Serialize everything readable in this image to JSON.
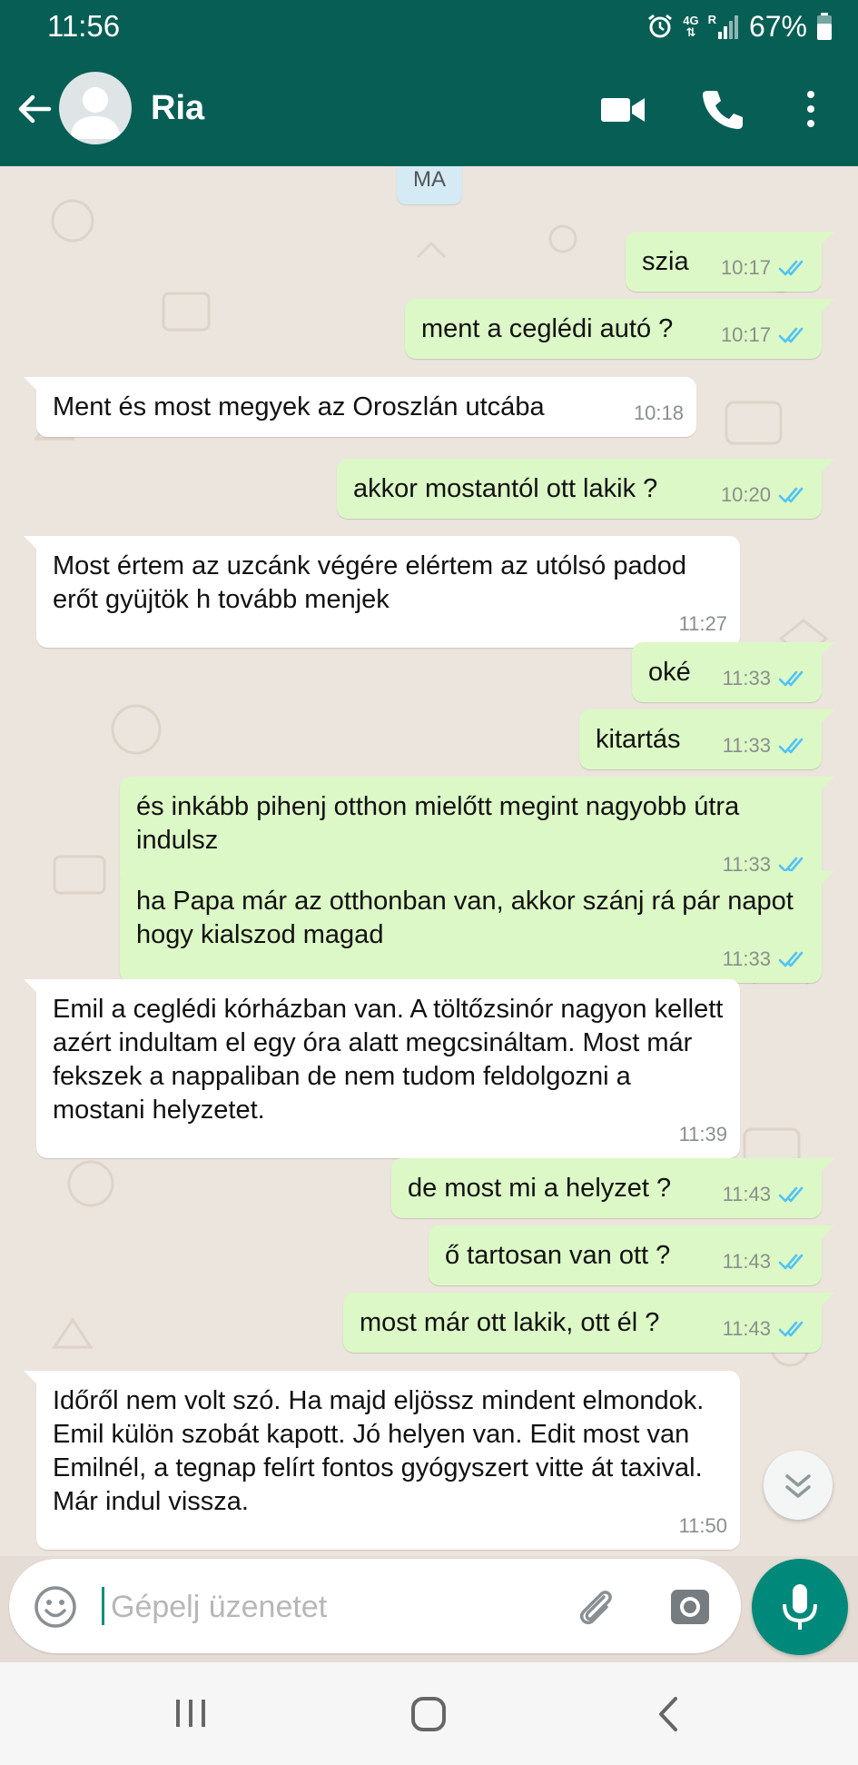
{
  "status_bar": {
    "time": "11:56",
    "network": "4G",
    "roaming": "R",
    "battery": "67%"
  },
  "header": {
    "contact_name": "Ria",
    "icons": [
      "back-arrow-icon",
      "avatar",
      "video-call-icon",
      "voice-call-icon",
      "more-options-icon"
    ]
  },
  "chat": {
    "date_label": "MA",
    "messages": [
      {
        "dir": "out",
        "text": "szia",
        "time": "10:17",
        "read": true
      },
      {
        "dir": "out",
        "text": "ment a ceglédi autó ?",
        "time": "10:17",
        "read": true
      },
      {
        "dir": "in",
        "text": "Ment és most megyek az Oroszlán utcába",
        "time": "10:18"
      },
      {
        "dir": "out",
        "text": "akkor mostantól ott lakik ?",
        "time": "10:20",
        "read": true
      },
      {
        "dir": "in",
        "text": "Most értem az uzcánk végére elértem az utólsó padod erőt gyüjtök h tovább menjek",
        "time": "11:27"
      },
      {
        "dir": "out",
        "text": "oké",
        "time": "11:33",
        "read": true
      },
      {
        "dir": "out",
        "text": "kitartás",
        "time": "11:33",
        "read": true
      },
      {
        "dir": "out",
        "text": "és inkább pihenj otthon mielőtt megint nagyobb útra indulsz",
        "time": "11:33",
        "read": true
      },
      {
        "dir": "out",
        "text": "ha Papa már az otthonban van, akkor szánj rá pár napot hogy kialszod magad",
        "time": "11:33",
        "read": true
      },
      {
        "dir": "in",
        "text": "Emil a ceglédi kórházban van. A töltőzsinór nagyon kellett azért indultam el egy óra alatt megcsináltam. Most már fekszek a nappaliban de nem tudom feldolgozni a mostani helyzetet.",
        "time": "11:39"
      },
      {
        "dir": "out",
        "text": "de most mi a helyzet ?",
        "time": "11:43",
        "read": true
      },
      {
        "dir": "out",
        "text": "ő tartosan van ott ?",
        "time": "11:43",
        "read": true
      },
      {
        "dir": "out",
        "text": "most már ott lakik, ott él ?",
        "time": "11:43",
        "read": true
      },
      {
        "dir": "in",
        "text": "Időről nem volt szó. Ha majd eljössz mindent elmondok. Emil külön szobát kapott. Jó helyen van. Edit most van Emilnél, a tegnap felírt fontos gyógyszert vitte át taxival. Már indul vissza.",
        "time": "11:50"
      }
    ]
  },
  "composer": {
    "placeholder": "Gépelj üzenetet",
    "value": ""
  },
  "colors": {
    "header": "#075e54",
    "outgoing_bubble": "#dcf8c6",
    "incoming_bubble": "#ffffff",
    "read_ticks": "#4fc3f7",
    "mic_button": "#00897b"
  }
}
